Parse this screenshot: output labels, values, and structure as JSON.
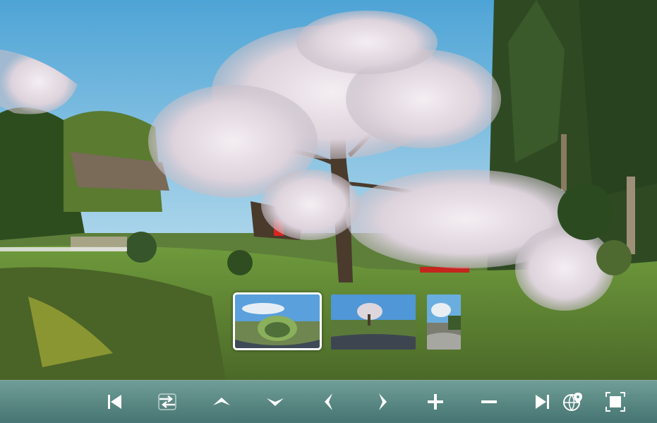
{
  "viewer": {
    "scene_name": "weeping-cherry-tree-panorama",
    "accent_color": "#ffffff",
    "toolbar_color": "#5f9ea0"
  },
  "thumbnails": [
    {
      "name": "thumbnail-1",
      "active": true
    },
    {
      "name": "thumbnail-2",
      "active": false
    },
    {
      "name": "thumbnail-3",
      "active": false
    }
  ],
  "toolbar": {
    "buttons": [
      {
        "name": "first-scene-button",
        "icon": "skip-to-start-icon"
      },
      {
        "name": "autorotate-toggle-button",
        "icon": "swap-arrows-icon"
      },
      {
        "name": "move-up-button",
        "icon": "chevron-up-icon"
      },
      {
        "name": "move-down-button",
        "icon": "chevron-down-icon"
      },
      {
        "name": "move-left-button",
        "icon": "chevron-left-icon"
      },
      {
        "name": "move-right-button",
        "icon": "chevron-right-icon"
      },
      {
        "name": "zoom-in-button",
        "icon": "plus-icon"
      },
      {
        "name": "zoom-out-button",
        "icon": "minus-icon"
      },
      {
        "name": "last-scene-button",
        "icon": "skip-to-end-icon"
      },
      {
        "name": "map-button",
        "icon": "globe-pin-icon"
      },
      {
        "name": "fullscreen-button",
        "icon": "fullscreen-icon"
      }
    ]
  }
}
